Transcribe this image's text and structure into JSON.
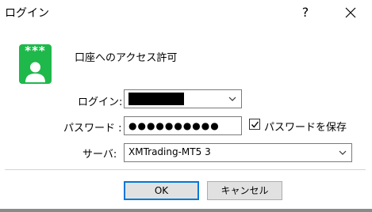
{
  "window": {
    "title": "ログイン"
  },
  "titlebar": {
    "help_glyph": "?",
    "close_icon": "close-icon"
  },
  "dialog": {
    "icon": "account-key-icon",
    "icon_stars": "***",
    "heading": "口座へのアクセス許可"
  },
  "form": {
    "login_label": "ログイン:",
    "password_label": "パスワード :",
    "password_value": "●●●●●●●●●●",
    "save_password_label": "パスワードを保存",
    "save_password_checked": true,
    "server_label": "サーバ:",
    "server_value": "XMTrading-MT5 3"
  },
  "buttons": {
    "ok": "OK",
    "cancel": "キャンセル"
  },
  "colors": {
    "icon_green": "#1fb84b",
    "focus_blue": "#0078d7",
    "button_face": "#e1e1e1"
  }
}
